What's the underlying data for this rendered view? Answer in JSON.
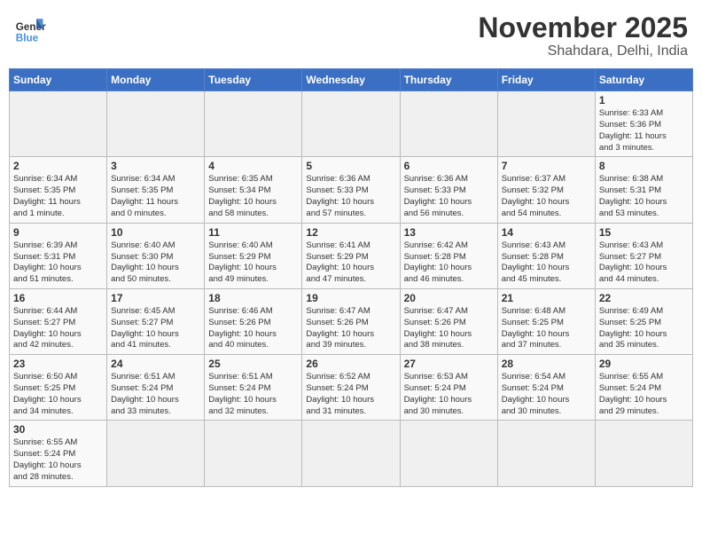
{
  "header": {
    "logo_general": "General",
    "logo_blue": "Blue",
    "month_year": "November 2025",
    "location": "Shahdara, Delhi, India"
  },
  "weekdays": [
    "Sunday",
    "Monday",
    "Tuesday",
    "Wednesday",
    "Thursday",
    "Friday",
    "Saturday"
  ],
  "weeks": [
    [
      {
        "day": "",
        "info": ""
      },
      {
        "day": "",
        "info": ""
      },
      {
        "day": "",
        "info": ""
      },
      {
        "day": "",
        "info": ""
      },
      {
        "day": "",
        "info": ""
      },
      {
        "day": "",
        "info": ""
      },
      {
        "day": "1",
        "info": "Sunrise: 6:33 AM\nSunset: 5:36 PM\nDaylight: 11 hours\nand 3 minutes."
      }
    ],
    [
      {
        "day": "2",
        "info": "Sunrise: 6:34 AM\nSunset: 5:35 PM\nDaylight: 11 hours\nand 1 minute."
      },
      {
        "day": "3",
        "info": "Sunrise: 6:34 AM\nSunset: 5:35 PM\nDaylight: 11 hours\nand 0 minutes."
      },
      {
        "day": "4",
        "info": "Sunrise: 6:35 AM\nSunset: 5:34 PM\nDaylight: 10 hours\nand 58 minutes."
      },
      {
        "day": "5",
        "info": "Sunrise: 6:36 AM\nSunset: 5:33 PM\nDaylight: 10 hours\nand 57 minutes."
      },
      {
        "day": "6",
        "info": "Sunrise: 6:36 AM\nSunset: 5:33 PM\nDaylight: 10 hours\nand 56 minutes."
      },
      {
        "day": "7",
        "info": "Sunrise: 6:37 AM\nSunset: 5:32 PM\nDaylight: 10 hours\nand 54 minutes."
      },
      {
        "day": "8",
        "info": "Sunrise: 6:38 AM\nSunset: 5:31 PM\nDaylight: 10 hours\nand 53 minutes."
      }
    ],
    [
      {
        "day": "9",
        "info": "Sunrise: 6:39 AM\nSunset: 5:31 PM\nDaylight: 10 hours\nand 51 minutes."
      },
      {
        "day": "10",
        "info": "Sunrise: 6:40 AM\nSunset: 5:30 PM\nDaylight: 10 hours\nand 50 minutes."
      },
      {
        "day": "11",
        "info": "Sunrise: 6:40 AM\nSunset: 5:29 PM\nDaylight: 10 hours\nand 49 minutes."
      },
      {
        "day": "12",
        "info": "Sunrise: 6:41 AM\nSunset: 5:29 PM\nDaylight: 10 hours\nand 47 minutes."
      },
      {
        "day": "13",
        "info": "Sunrise: 6:42 AM\nSunset: 5:28 PM\nDaylight: 10 hours\nand 46 minutes."
      },
      {
        "day": "14",
        "info": "Sunrise: 6:43 AM\nSunset: 5:28 PM\nDaylight: 10 hours\nand 45 minutes."
      },
      {
        "day": "15",
        "info": "Sunrise: 6:43 AM\nSunset: 5:27 PM\nDaylight: 10 hours\nand 44 minutes."
      }
    ],
    [
      {
        "day": "16",
        "info": "Sunrise: 6:44 AM\nSunset: 5:27 PM\nDaylight: 10 hours\nand 42 minutes."
      },
      {
        "day": "17",
        "info": "Sunrise: 6:45 AM\nSunset: 5:27 PM\nDaylight: 10 hours\nand 41 minutes."
      },
      {
        "day": "18",
        "info": "Sunrise: 6:46 AM\nSunset: 5:26 PM\nDaylight: 10 hours\nand 40 minutes."
      },
      {
        "day": "19",
        "info": "Sunrise: 6:47 AM\nSunset: 5:26 PM\nDaylight: 10 hours\nand 39 minutes."
      },
      {
        "day": "20",
        "info": "Sunrise: 6:47 AM\nSunset: 5:26 PM\nDaylight: 10 hours\nand 38 minutes."
      },
      {
        "day": "21",
        "info": "Sunrise: 6:48 AM\nSunset: 5:25 PM\nDaylight: 10 hours\nand 37 minutes."
      },
      {
        "day": "22",
        "info": "Sunrise: 6:49 AM\nSunset: 5:25 PM\nDaylight: 10 hours\nand 35 minutes."
      }
    ],
    [
      {
        "day": "23",
        "info": "Sunrise: 6:50 AM\nSunset: 5:25 PM\nDaylight: 10 hours\nand 34 minutes."
      },
      {
        "day": "24",
        "info": "Sunrise: 6:51 AM\nSunset: 5:24 PM\nDaylight: 10 hours\nand 33 minutes."
      },
      {
        "day": "25",
        "info": "Sunrise: 6:51 AM\nSunset: 5:24 PM\nDaylight: 10 hours\nand 32 minutes."
      },
      {
        "day": "26",
        "info": "Sunrise: 6:52 AM\nSunset: 5:24 PM\nDaylight: 10 hours\nand 31 minutes."
      },
      {
        "day": "27",
        "info": "Sunrise: 6:53 AM\nSunset: 5:24 PM\nDaylight: 10 hours\nand 30 minutes."
      },
      {
        "day": "28",
        "info": "Sunrise: 6:54 AM\nSunset: 5:24 PM\nDaylight: 10 hours\nand 30 minutes."
      },
      {
        "day": "29",
        "info": "Sunrise: 6:55 AM\nSunset: 5:24 PM\nDaylight: 10 hours\nand 29 minutes."
      }
    ],
    [
      {
        "day": "30",
        "info": "Sunrise: 6:55 AM\nSunset: 5:24 PM\nDaylight: 10 hours\nand 28 minutes."
      },
      {
        "day": "",
        "info": ""
      },
      {
        "day": "",
        "info": ""
      },
      {
        "day": "",
        "info": ""
      },
      {
        "day": "",
        "info": ""
      },
      {
        "day": "",
        "info": ""
      },
      {
        "day": "",
        "info": ""
      }
    ]
  ]
}
